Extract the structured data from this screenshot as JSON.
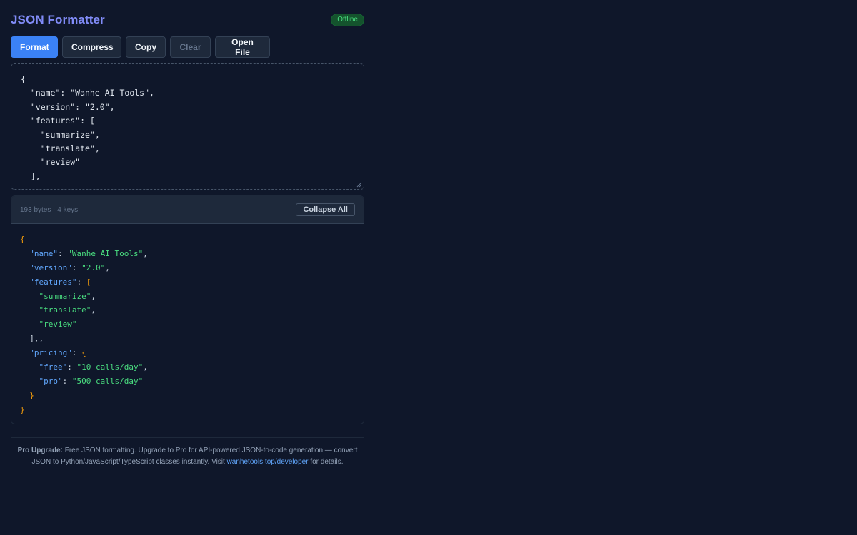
{
  "app": {
    "title": "JSON Formatter",
    "status_badge": "Offline"
  },
  "toolbar": {
    "format_label": "Format",
    "compress_label": "Compress",
    "copy_label": "Copy",
    "clear_label": "Clear",
    "open_file_label": "Open File"
  },
  "editor": {
    "lines": [
      "{",
      "  \"name\": \"Wanhe AI Tools\",",
      "  \"version\": \"2.0\",",
      "  \"features\": [",
      "    \"summarize\",",
      "    \"translate\",",
      "    \"review\"",
      "  ],"
    ]
  },
  "output": {
    "stats": "193 bytes · 4 keys",
    "collapse_label": "Collapse All",
    "lines": [
      {
        "indent": "",
        "parts": [
          {
            "t": "brace",
            "v": "{"
          }
        ]
      },
      {
        "indent": "  ",
        "parts": [
          {
            "t": "key",
            "v": "\"name\""
          },
          {
            "t": "punct",
            "v": ": "
          },
          {
            "t": "str",
            "v": "\"Wanhe AI Tools\""
          },
          {
            "t": "punct",
            "v": ","
          }
        ]
      },
      {
        "indent": "  ",
        "parts": [
          {
            "t": "key",
            "v": "\"version\""
          },
          {
            "t": "punct",
            "v": ": "
          },
          {
            "t": "str",
            "v": "\"2.0\""
          },
          {
            "t": "punct",
            "v": ","
          }
        ]
      },
      {
        "indent": "  ",
        "parts": [
          {
            "t": "key",
            "v": "\"features\""
          },
          {
            "t": "punct",
            "v": ": "
          },
          {
            "t": "brace",
            "v": "["
          }
        ]
      },
      {
        "indent": "    ",
        "parts": [
          {
            "t": "str",
            "v": "\"summarize\""
          },
          {
            "t": "punct",
            "v": ","
          }
        ]
      },
      {
        "indent": "    ",
        "parts": [
          {
            "t": "str",
            "v": "\"translate\""
          },
          {
            "t": "punct",
            "v": ","
          }
        ]
      },
      {
        "indent": "    ",
        "parts": [
          {
            "t": "str",
            "v": "\"review\""
          }
        ]
      },
      {
        "indent": "  ",
        "parts": [
          {
            "t": "punct",
            "v": "],,"
          }
        ]
      },
      {
        "indent": "  ",
        "parts": [
          {
            "t": "key",
            "v": "\"pricing\""
          },
          {
            "t": "punct",
            "v": ": "
          },
          {
            "t": "brace",
            "v": "{"
          }
        ]
      },
      {
        "indent": "    ",
        "parts": [
          {
            "t": "key",
            "v": "\"free\""
          },
          {
            "t": "punct",
            "v": ": "
          },
          {
            "t": "str",
            "v": "\"10 calls/day\""
          },
          {
            "t": "punct",
            "v": ","
          }
        ]
      },
      {
        "indent": "    ",
        "parts": [
          {
            "t": "key",
            "v": "\"pro\""
          },
          {
            "t": "punct",
            "v": ": "
          },
          {
            "t": "str",
            "v": "\"500 calls/day\""
          }
        ]
      },
      {
        "indent": "  ",
        "parts": [
          {
            "t": "brace",
            "v": "}"
          }
        ]
      },
      {
        "indent": "",
        "parts": [
          {
            "t": "brace",
            "v": "}"
          }
        ]
      }
    ]
  },
  "footer": {
    "label": "Pro Upgrade:",
    "text_before_link": " Free JSON formatting. Upgrade to Pro for API-powered JSON-to-code generation — convert JSON to Python/JavaScript/TypeScript classes instantly. Visit ",
    "link_text": "wanhetools.top/developer",
    "text_after_link": " for details."
  },
  "colors": {
    "background": "#0f172a",
    "accent": "#3b82f6",
    "title": "#818cf8",
    "json_key": "#60a5fa",
    "json_string": "#4ade80",
    "json_brace": "#f59e0b",
    "badge": "#4ade80"
  },
  "icons": {
    "resize": "resize-grip-icon"
  }
}
